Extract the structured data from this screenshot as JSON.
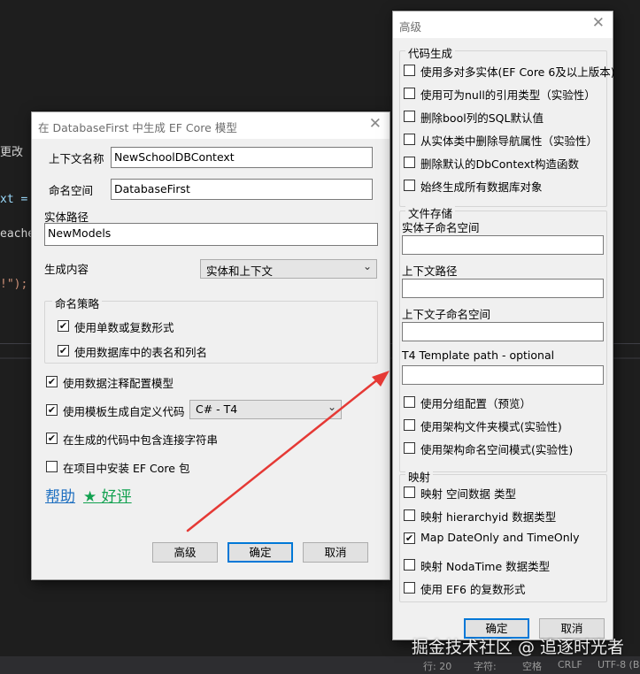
{
  "editor": {
    "frag_1": "更改",
    "frag_2": "xt =",
    "frag_3": "eache",
    "frag_4": "!\");"
  },
  "statusbar": {
    "item_1": "行: 20",
    "item_2": "字符:",
    "item_3": "空格",
    "item_4": "CRLF",
    "item_5": "UTF-8 (B"
  },
  "watermark": "掘金技术社区 @ 追逐时光者",
  "colors": {
    "arrow": "#e53935",
    "accent": "#0078d7",
    "help_link": "#1e6fc0",
    "review_link": "#12a150"
  },
  "main_dialog": {
    "title": "在 DatabaseFirst 中生成 EF Core 模型",
    "close_icon": "✕",
    "context_name_label": "上下文名称",
    "context_name_value": "NewSchoolDBContext",
    "namespace_label": "命名空间",
    "namespace_value": "DatabaseFirst",
    "entity_path_label": "实体路径",
    "entity_path_value": "NewModels",
    "generate_label": "生成内容",
    "generate_value": "实体和上下文",
    "naming_group_title": "命名策略",
    "naming_options": [
      {
        "label": "使用单数或复数形式",
        "checked": true
      },
      {
        "label": "使用数据库中的表名和列名",
        "checked": true
      }
    ],
    "options": [
      {
        "label": "使用数据注释配置模型",
        "checked": true
      },
      {
        "label": "使用模板生成自定义代码",
        "checked": true
      },
      {
        "label": "在生成的代码中包含连接字符串",
        "checked": true
      },
      {
        "label": "在项目中安装 EF Core 包",
        "checked": false
      }
    ],
    "template_value": "C# - T4",
    "help_link": "帮助",
    "review_link": "★ 好评",
    "advanced_button": "高级",
    "ok_button": "确定",
    "cancel_button": "取消"
  },
  "advanced_dialog": {
    "title": "高级",
    "close_icon": "✕",
    "codegen_group": "代码生成",
    "codegen_options": [
      {
        "label": "使用多对多实体(EF Core 6及以上版本)",
        "checked": false
      },
      {
        "label": "使用可为null的引用类型（实验性）",
        "checked": false
      },
      {
        "label": "删除bool列的SQL默认值",
        "checked": false
      },
      {
        "label": "从实体类中删除导航属性（实验性）",
        "checked": false
      },
      {
        "label": "删除默认的DbContext构造函数",
        "checked": false
      },
      {
        "label": "始终生成所有数据库对象",
        "checked": false
      }
    ],
    "storage_group": "文件存储",
    "entity_sub_ns_label": "实体子命名空间",
    "entity_sub_ns_value": "",
    "context_path_label": "上下文路径",
    "context_path_value": "",
    "context_sub_ns_label": "上下文子命名空间",
    "context_sub_ns_value": "",
    "t4_path_label": "T4 Template path - optional",
    "t4_path_value": "",
    "storage_options": [
      {
        "label": "使用分组配置（预览）",
        "checked": false
      },
      {
        "label": "使用架构文件夹模式(实验性)",
        "checked": false
      },
      {
        "label": "使用架构命名空间模式(实验性)",
        "checked": false
      }
    ],
    "mapping_group": "映射",
    "mapping_options": [
      {
        "label": "映射 空间数据 类型",
        "checked": false
      },
      {
        "label": "映射 hierarchyid 数据类型",
        "checked": false
      },
      {
        "label": "Map DateOnly and TimeOnly",
        "checked": true
      },
      {
        "label": "映射 NodaTime 数据类型",
        "checked": false
      },
      {
        "label": "使用 EF6 的复数形式",
        "checked": false
      }
    ],
    "ok_button": "确定",
    "cancel_button": "取消"
  }
}
